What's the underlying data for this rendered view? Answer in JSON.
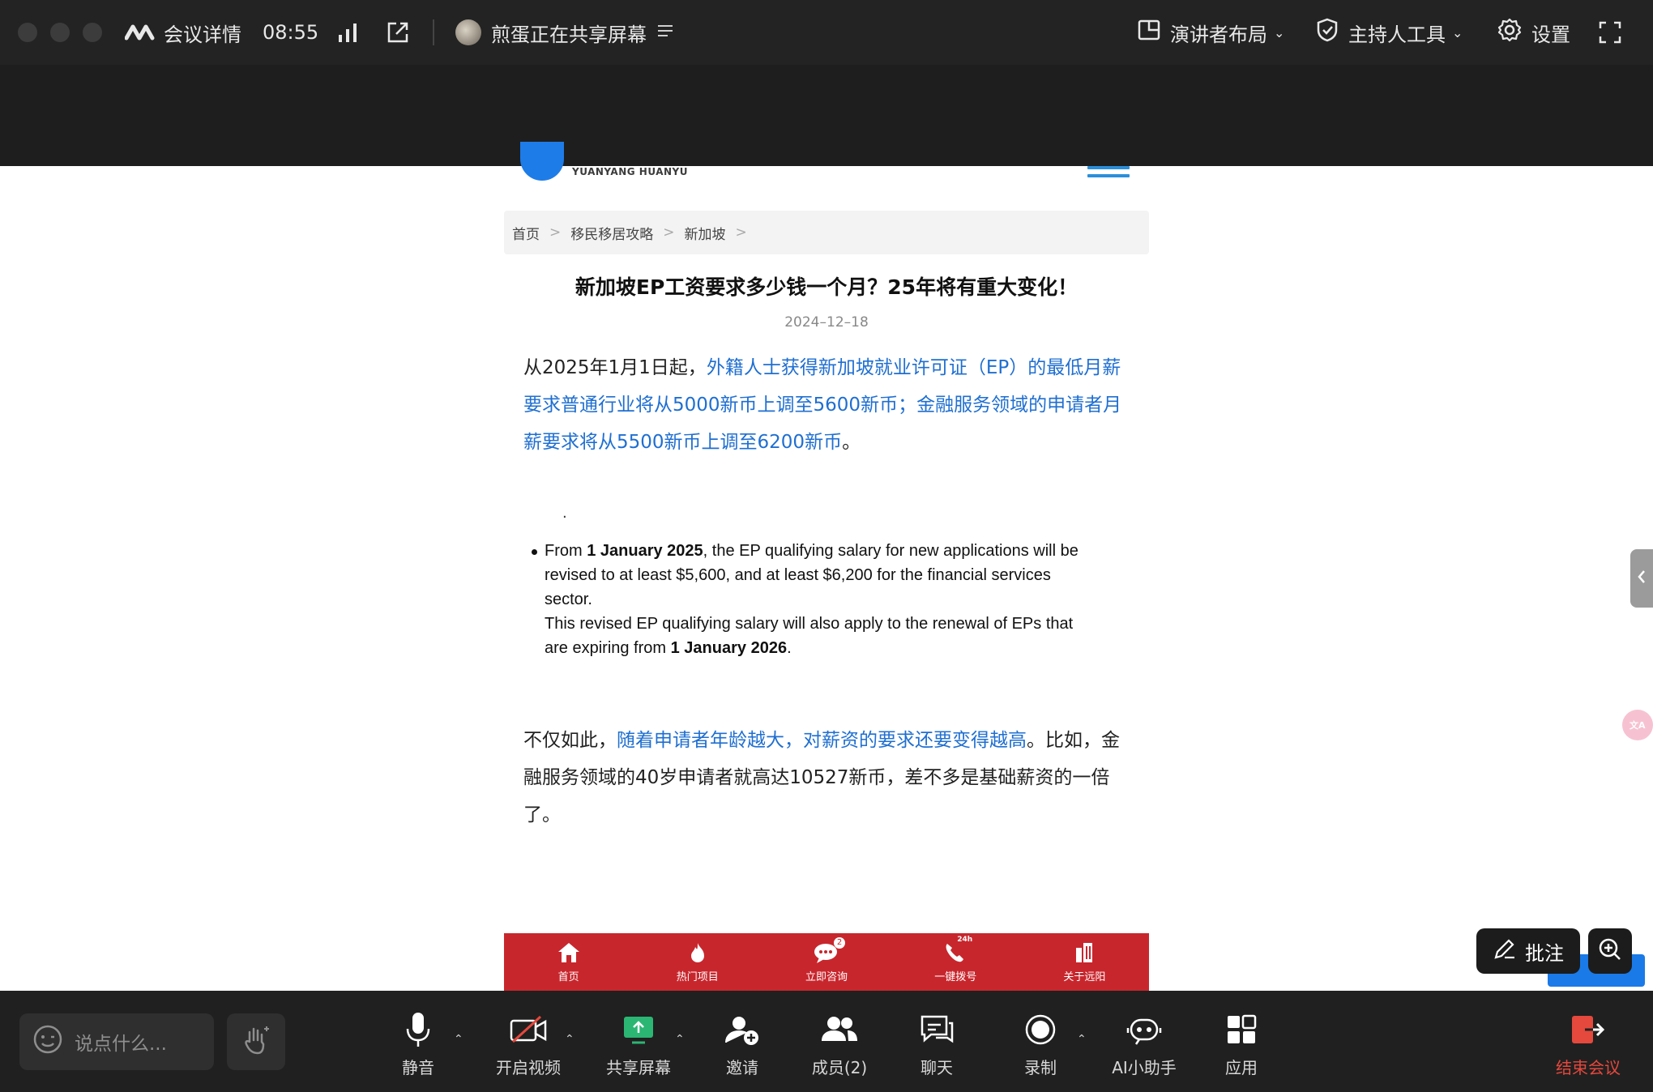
{
  "topbar": {
    "meeting_details": "会议详情",
    "time": "08:55",
    "sharer_status": "煎蛋正在共享屏幕",
    "layout_label": "演讲者布局",
    "host_tools_label": "主持人工具",
    "settings_label": "设置"
  },
  "article": {
    "logo_text": "YUANYANG HUANYU",
    "breadcrumb": [
      "首页",
      "移民移居攻略",
      "新加坡"
    ],
    "breadcrumb_sep": ">",
    "title": "新加坡EP工资要求多少钱一个月？25年将有重大变化！",
    "date": "2024–12–18",
    "para1_prefix": "从2025年1月1日起，",
    "para1_link": "外籍人士获得新加坡就业许可证（EP）的最低月薪要求普通行业将从5000新币上调至5600新币；金融服务领域的申请者月薪要求将从5500新币上调至6200新币",
    "para1_suffix": "。",
    "quote_stray": ".",
    "quote_l1a": "From ",
    "quote_l1b": "1 January 2025",
    "quote_l1c": ", the EP qualifying salary for new applications will be revised to at least $5,600, and at least $6,200 for the financial services sector.",
    "quote_l2a": "This revised EP qualifying salary will also apply to the renewal of EPs that are expiring from ",
    "quote_l2b": "1 January 2026",
    "quote_l2c": ".",
    "para2_prefix": "不仅如此，",
    "para2_link": "随着申请者年龄越大，对薪资的要求还要变得越高",
    "para2_suffix": "。比如，金融服务领域的40岁申请者就高达10527新币，差不多是基础薪资的一倍了。",
    "footer_nav": [
      "首页",
      "热门项目",
      "立即咨询",
      "一键拨号",
      "关于远阳"
    ],
    "consult_badge": "2",
    "phone_badge": "24h"
  },
  "overlay": {
    "annotate_label": "批注"
  },
  "toolbar": {
    "chat_placeholder": "说点什么...",
    "mute": "静音",
    "video": "开启视频",
    "share": "共享屏幕",
    "invite": "邀请",
    "members": "成员(2)",
    "chat": "聊天",
    "record": "录制",
    "ai": "AI小助手",
    "apps": "应用",
    "end": "结束会议"
  },
  "colors": {
    "link_blue": "#1f6fd1",
    "footer_red": "#c8262d",
    "end_red": "#e5483d",
    "share_green": "#2bb673"
  }
}
